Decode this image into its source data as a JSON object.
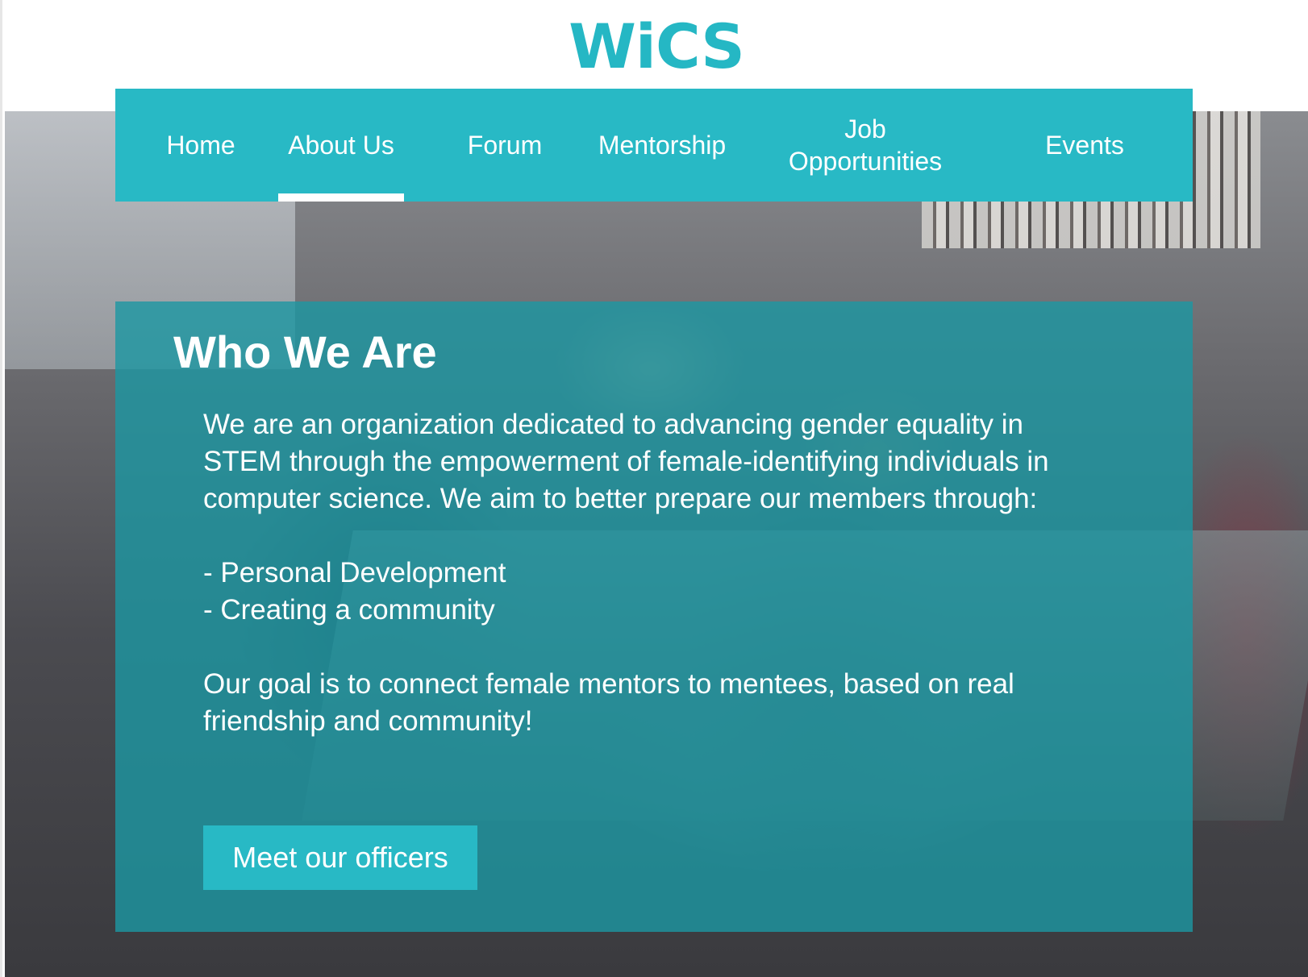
{
  "brand": {
    "logo_text": "WiCS",
    "accent_color": "#28b9c5"
  },
  "nav": {
    "items": [
      {
        "label": "Home"
      },
      {
        "label": "About Us",
        "active": true
      },
      {
        "label": "Forum"
      },
      {
        "label": "Mentorship"
      },
      {
        "label": "Job Opportunities"
      },
      {
        "label": "Events"
      }
    ]
  },
  "about": {
    "title": "Who We Are",
    "intro": "We are an organization dedicated to advancing gender equality in STEM through the empowerment of female-identifying individuals in computer science. We aim to better prepare our members through:",
    "list": [
      "- Personal Development",
      "- Creating a community"
    ],
    "goal": "Our goal is to connect female mentors to mentees, based on real friendship and community!",
    "cta_label": "Meet our officers"
  }
}
